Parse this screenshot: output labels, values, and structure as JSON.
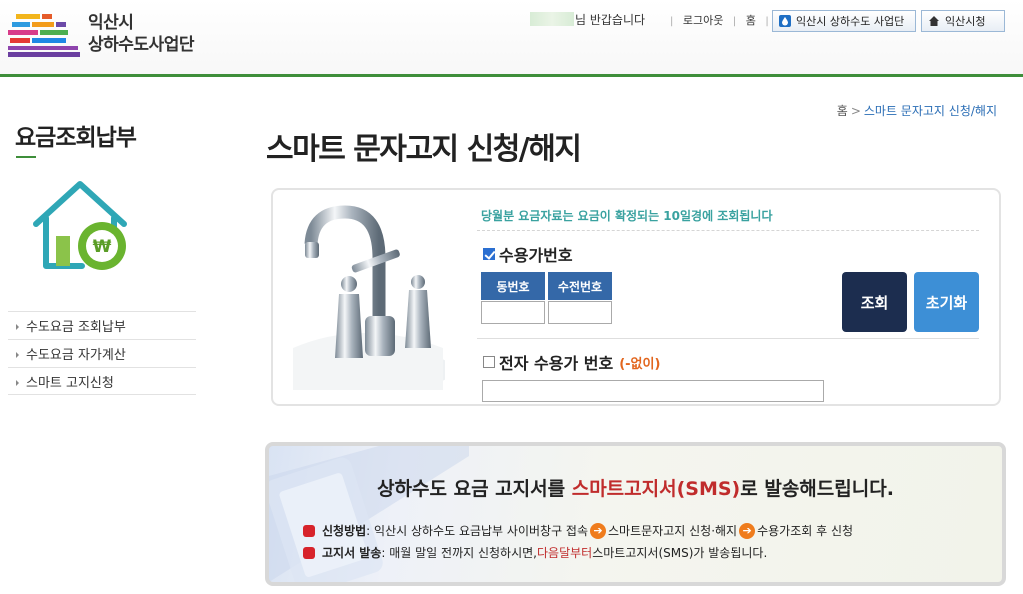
{
  "header": {
    "org_line1": "익산시",
    "org_line2": "상하수도사업단",
    "greeting": "님 반갑습니다",
    "logout": "로그아웃",
    "home": "홈",
    "btn_water": "익산시 상하수도 사업단",
    "btn_city": "익산시청",
    "accent": "#3e8e3a"
  },
  "sidebar": {
    "title": "요금조회납부",
    "items": [
      {
        "label": "수도요금 조회납부"
      },
      {
        "label": "수도요금 자가계산"
      },
      {
        "label": "스마트 고지신청"
      }
    ]
  },
  "breadcrumb": {
    "home": "홈",
    "arrow": ">",
    "current": "스마트 문자고지 신청/해지"
  },
  "page_title": "스마트 문자고지 신청/해지",
  "search": {
    "notice": "당월분 요금자료는 요금이 확정되는 10일경에 조회됩니다",
    "customer_no_label": "수용가번호",
    "customer_no_checked": true,
    "dong_label": "동번호",
    "meter_label": "수전번호",
    "dong_value": "",
    "meter_value": "",
    "search_button": "조회",
    "reset_button": "초기화",
    "e_customer_label": "전자 수용가 번호",
    "e_customer_note": "(-없이)",
    "e_customer_checked": false,
    "e_customer_value": ""
  },
  "banner": {
    "head_pre": "상하수도 요금 고지서를 ",
    "head_hl": "스마트고지서(SMS)",
    "head_post": "로 발송해드립니다.",
    "row1_label": "신청방법",
    "row1_text": " : 익산시 상하수도 요금납부 사이버창구 접속",
    "row1_step2": "스마트문자고지 신청·해지",
    "row1_step3": "수용가조회 후 신청",
    "row2_label": "고지서 발송",
    "row2_text": " : 매월 말일 전까지 신청하시면, ",
    "row2_hl": "다음달부터",
    "row2_post": " 스마트고지서(SMS)가 발송됩니다."
  }
}
